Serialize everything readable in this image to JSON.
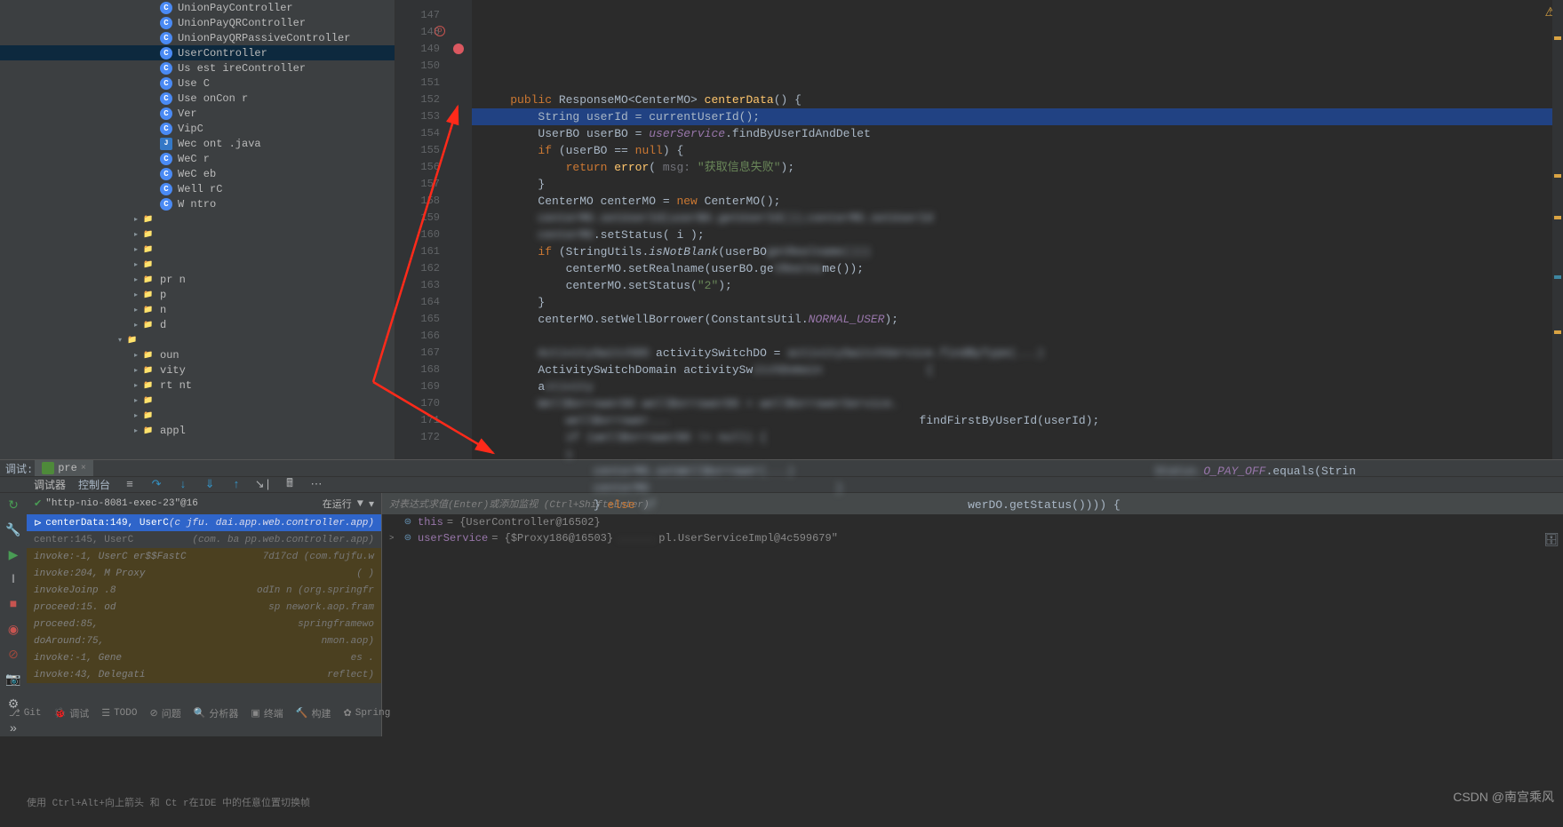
{
  "projectTree": {
    "items": [
      {
        "indent": 180,
        "icon": "class-c",
        "label": "UnionPayController"
      },
      {
        "indent": 180,
        "icon": "class-c",
        "label": "UnionPayQRController"
      },
      {
        "indent": 180,
        "icon": "class-c",
        "label": "UnionPayQRPassiveController"
      },
      {
        "indent": 180,
        "icon": "class-c",
        "label": "UserController",
        "selected": true
      },
      {
        "indent": 180,
        "icon": "class-c",
        "label": "Us    est      ireController"
      },
      {
        "indent": 180,
        "icon": "class-c",
        "label": "Use   C"
      },
      {
        "indent": 180,
        "icon": "class-c",
        "label": "Use          onCon     r"
      },
      {
        "indent": 180,
        "icon": "class-c",
        "label": "Ver"
      },
      {
        "indent": 180,
        "icon": "class-c",
        "label": "VipC"
      },
      {
        "indent": 180,
        "icon": "java",
        "label": "Wec              ont      .java"
      },
      {
        "indent": 180,
        "icon": "class-c",
        "label": "WeC         r"
      },
      {
        "indent": 180,
        "icon": "class-c",
        "label": "WeC     eb"
      },
      {
        "indent": 180,
        "icon": "class-c",
        "label": "Well    rC"
      },
      {
        "indent": 180,
        "icon": "class-c",
        "label": "W       ntro"
      },
      {
        "indent": 148,
        "chev": ">",
        "icon": "folder",
        "label": ""
      },
      {
        "indent": 148,
        "chev": ">",
        "icon": "folder",
        "label": ""
      },
      {
        "indent": 148,
        "chev": ">",
        "icon": "folder",
        "label": ""
      },
      {
        "indent": 148,
        "chev": ">",
        "icon": "folder",
        "label": ""
      },
      {
        "indent": 148,
        "chev": ">",
        "icon": "folder",
        "label": "  pr      n"
      },
      {
        "indent": 148,
        "chev": ">",
        "icon": "folder",
        "label": "  p"
      },
      {
        "indent": 148,
        "chev": ">",
        "icon": "folder",
        "label": "     n"
      },
      {
        "indent": 148,
        "chev": ">",
        "icon": "folder",
        "label": "    d"
      },
      {
        "indent": 130,
        "chev": "v",
        "icon": "folder",
        "label": ""
      },
      {
        "indent": 148,
        "chev": ">",
        "icon": "folder",
        "label": "  oun"
      },
      {
        "indent": 148,
        "chev": ">",
        "icon": "folder",
        "label": "     vity"
      },
      {
        "indent": 148,
        "chev": ">",
        "icon": "folder",
        "label": "   rt       nt"
      },
      {
        "indent": 148,
        "chev": ">",
        "icon": "folder",
        "label": ""
      },
      {
        "indent": 148,
        "chev": ">",
        "icon": "folder",
        "label": ""
      },
      {
        "indent": 148,
        "chev": ">",
        "icon": "folder",
        "label": "appl"
      }
    ]
  },
  "editor": {
    "startLine": 147,
    "lines": [
      {
        "n": 147,
        "html": ""
      },
      {
        "n": 148,
        "html": "    <span class='kw'>public</span> ResponseMO&lt;CenterMO&gt; <span class='method'>centerData</span>() {",
        "icon": "override"
      },
      {
        "n": 149,
        "html": "        String userId = currentUserId();",
        "exec": true,
        "bp": true
      },
      {
        "n": 150,
        "html": "        UserBO userBO = <span class='const'>userService</span>.findByUserIdAndDelet"
      },
      {
        "n": 151,
        "html": "        <span class='kw'>if</span> (userBO == <span class='kw'>null</span>) {"
      },
      {
        "n": 152,
        "html": "            <span class='kw'>return</span> <span class='method'>error</span>( <span class='param'>msg:</span> <span class='str'>\"获取信息失败\"</span>);"
      },
      {
        "n": 153,
        "html": "        }"
      },
      {
        "n": 154,
        "html": "        CenterMO centerMO = <span class='kw'>new</span> CenterMO();"
      },
      {
        "n": 155,
        "html": "        <span class='blur'>centerMO.setUserId(userBO.getUserId());centerMO.setUserId</span>"
      },
      {
        "n": 156,
        "html": "        <span class='blur'>centerMO</span>.setStatus( i );"
      },
      {
        "n": 157,
        "html": "        <span class='kw'>if</span> (StringUtils.<span style='font-style:italic'>isNotBlank</span>(userBO<span class='blur'>getRealname()))</span>"
      },
      {
        "n": 158,
        "html": "            centerMO.setRealname(userBO.ge<span class='blur'>tRealna</span>me());"
      },
      {
        "n": 159,
        "html": "            centerMO.setStatus(<span class='str'>\"2\"</span>);"
      },
      {
        "n": 160,
        "html": "        }"
      },
      {
        "n": 161,
        "html": "        centerMO.setWellBorrower(ConstantsUtil.<span class='const'>NORMAL_USER</span>);"
      },
      {
        "n": 162,
        "html": ""
      },
      {
        "n": 163,
        "html": "        <span class='blur'>ActivitySwitchDO</span> activitySwitchDO = <span class='blur'>activitySwitchService.findByType(...)</span>"
      },
      {
        "n": 164,
        "html": "        ActivitySwitchDomain activitySw<span class='blur'>itchDomain               {</span>"
      },
      {
        "n": 165,
        "html": "        a<span class='blur'>ctivity</span>"
      },
      {
        "n": 166,
        "html": "        <span class='blur'>WellBorrowerDO wellBorrowerDO = wellBorrowerService.</span>"
      },
      {
        "n": 167,
        "html": "            <span class='blur'>wellBorrower...</span>                                    findFirstByUserId(userId);"
      },
      {
        "n": 168,
        "html": "            <span class='blur'>if (wellBorrowerDO != null) {</span>"
      },
      {
        "n": 169,
        "html": "            <span class='blur'>i</span>"
      },
      {
        "n": 170,
        "html": "                <span class='blur'>centerMO.setWellBorrower(...)                                                    Status.</span><span class='const'>O_PAY_OFF</span>.equals(Strin"
      },
      {
        "n": 171,
        "html": "                <span class='blur'>centerMO                           }</span>"
      },
      {
        "n": 172,
        "html": "                } <span class='kw'>else</span> <span class='blur'>if</span>                                             werDO.getStatus()))) {"
      }
    ]
  },
  "debug": {
    "tabLabel": "调试:",
    "configName": "pre",
    "toolbarTabs": {
      "debugger": "调试器",
      "console": "控制台"
    },
    "thread": "\"http-nio-8081-exec-23\"@16",
    "threadStatus": "在运行",
    "frames": [
      {
        "m": "centerData:149, UserC",
        "pkg": "(c      jfu.      dai.app.web.controller.app)",
        "sel": true
      },
      {
        "m": "center:145, UserC",
        "pkg": "(com.        ba         pp.web.controller.app)"
      },
      {
        "m": "invoke:-1, UserC      er$$FastC",
        "pkg": "    7d17cd (com.fujfu.w",
        "lib": true
      },
      {
        "m": "invoke:204, M       Proxy",
        "pkg": "(                         )",
        "lib": true
      },
      {
        "m": "invokeJoinp     .8",
        "pkg": "odIn        n  (org.springfr",
        "lib": true
      },
      {
        "m": "proceed:15.            od",
        "pkg": "sp       nework.aop.fram",
        "lib": true
      },
      {
        "m": "proceed:85,",
        "pkg": "springframewo",
        "lib": true
      },
      {
        "m": "doAround:75,",
        "pkg": "nmon.aop)",
        "lib": true
      },
      {
        "m": "invoke:-1, Gene",
        "pkg": "es            .",
        "lib": true
      },
      {
        "m": "invoke:43, Delegati",
        "pkg": "reflect)",
        "lib": true
      }
    ],
    "watchPlaceholder": "对表达式求值(Enter)或添加监视 (Ctrl+Shift+Enter)",
    "vars": [
      {
        "exp": "",
        "ov": "⊜",
        "name": "this",
        "val": "= {UserController@16502}"
      },
      {
        "exp": ">",
        "ov": "⊜",
        "name": "userService",
        "val": "= {$Proxy186@16503}",
        "extra": "pl.UserServiceImpl@4c599679\""
      }
    ],
    "hint": "使用 Ctrl+Alt+向上箭头 和 Ct           r在IDE 中的任意位置切换帧"
  },
  "statusBar": {
    "items": [
      "Git",
      "调试",
      "TODO",
      "问题",
      "分析器",
      "终端",
      "构建",
      "Spring"
    ]
  },
  "watermark": "CSDN @南宫乘风"
}
